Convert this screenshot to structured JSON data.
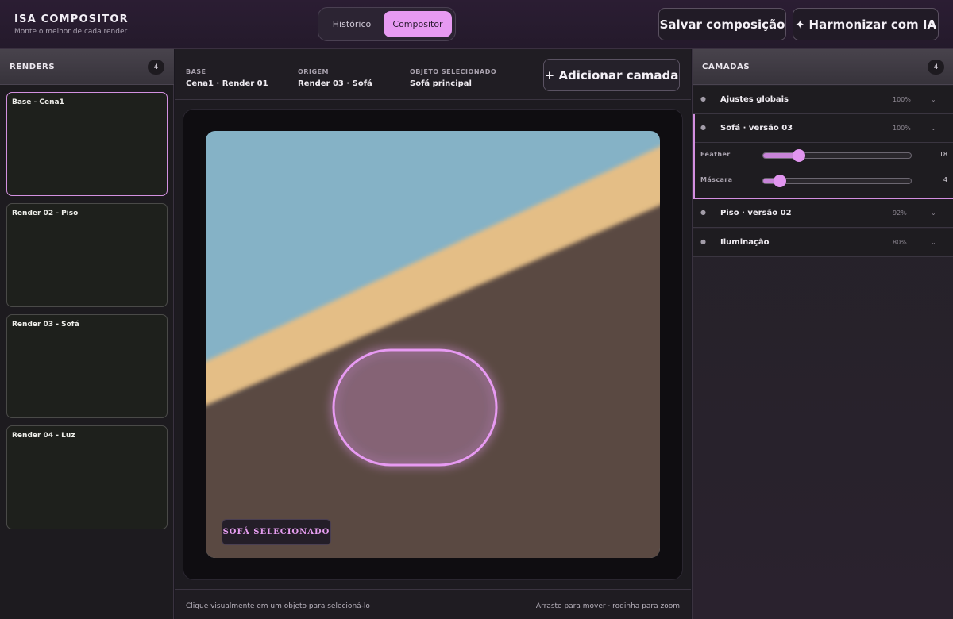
{
  "header": {
    "title": "ISA COMPOSITOR",
    "subtitle": "Monte o melhor de cada render",
    "tabs": [
      "Histórico",
      "Compositor"
    ],
    "active_tab": "Compositor",
    "save_label": "Salvar composição",
    "ai_label": "Harmonizar com IA",
    "ai_icon": "sparkle-icon"
  },
  "renders": {
    "title": "RENDERS",
    "count": "4",
    "items": [
      {
        "label": "Base - Cena1",
        "active": true
      },
      {
        "label": "Render 02 - Piso",
        "active": false
      },
      {
        "label": "Render 03 - Sofá",
        "active": false
      },
      {
        "label": "Render 04 - Luz",
        "active": false
      }
    ]
  },
  "info": {
    "base_key": "BASE",
    "base_value": "Cena1 · Render 01",
    "origin_key": "ORIGEM",
    "origin_value": "Render 03 · Sofá",
    "object_key": "OBJETO SELECIONADO",
    "object_value": "Sofá principal",
    "add_layer_label": "+ Adicionar camada"
  },
  "canvas": {
    "selection_tag": "SOFÁ SELECIONADO",
    "colors": {
      "sky": "#85b2c6",
      "band": "#e4be86",
      "floor": "#5a4842",
      "selection": "#e79af2"
    }
  },
  "footer": {
    "left_hint": "Clique visualmente em um objeto para selecioná-lo",
    "right_hint": "Arraste para mover · rodinha para zoom"
  },
  "layers": {
    "title": "CAMADAS",
    "count": "4",
    "items": [
      {
        "name": "Ajustes globais",
        "opacity": "100%"
      },
      {
        "name": "Sofá · versão 03",
        "opacity": "100%"
      },
      {
        "name": "Piso · versão 02",
        "opacity": "92%"
      },
      {
        "name": "Iluminação",
        "opacity": "80%"
      }
    ],
    "sliders": [
      {
        "label": "Feather",
        "value": "18",
        "fraction": 0.2
      },
      {
        "label": "Máscara",
        "value": "4",
        "fraction": 0.07
      }
    ]
  }
}
